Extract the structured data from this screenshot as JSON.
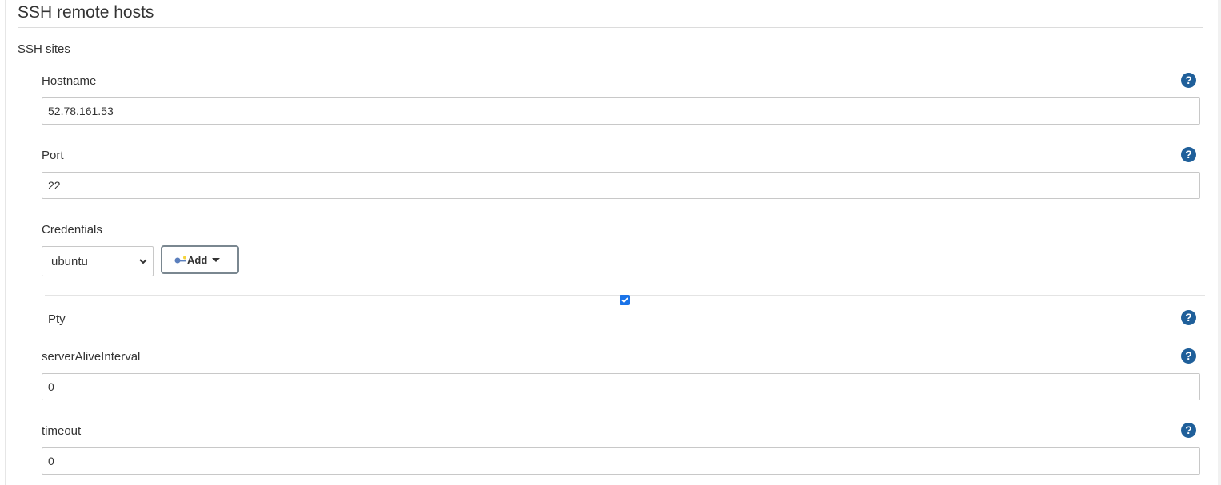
{
  "section": {
    "title": "SSH remote hosts",
    "subsection_title": "SSH sites"
  },
  "fields": {
    "hostname": {
      "label": "Hostname",
      "value": "52.78.161.53"
    },
    "port": {
      "label": "Port",
      "value": "22"
    },
    "credentials": {
      "label": "Credentials",
      "selected": "ubuntu",
      "add_label": "Add"
    },
    "pty": {
      "label": "Pty",
      "checked": true
    },
    "server_alive_interval": {
      "label": "serverAliveInterval",
      "value": "0"
    },
    "timeout": {
      "label": "timeout",
      "value": "0"
    }
  },
  "help_icon_glyph": "?",
  "colors": {
    "help_icon": "#1f5f9a",
    "checkbox": "#1a73e8"
  }
}
